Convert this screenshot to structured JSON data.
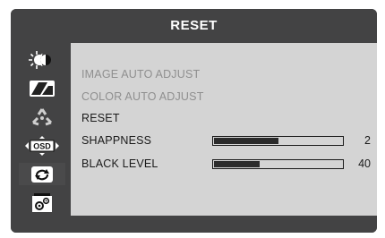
{
  "title": "RESET",
  "sidebar": {
    "items": [
      {
        "icon": "brightness-contrast-icon",
        "selected": false
      },
      {
        "icon": "image-icon",
        "selected": false
      },
      {
        "icon": "color-icon",
        "selected": false
      },
      {
        "icon": "osd-icon",
        "label": "OSD",
        "selected": false
      },
      {
        "icon": "reset-icon",
        "selected": true
      },
      {
        "icon": "setup-icon",
        "selected": false
      }
    ]
  },
  "menu": {
    "items": [
      {
        "label": "IMAGE AUTO ADJUST",
        "enabled": false
      },
      {
        "label": "COLOR AUTO ADJUST",
        "enabled": false
      },
      {
        "label": "RESET",
        "enabled": true
      },
      {
        "label": "SHAPPNESS",
        "enabled": true,
        "value": "2",
        "level": 0.5
      },
      {
        "label": "BLACK LEVEL",
        "enabled": true,
        "value": "40",
        "level": 0.36
      }
    ]
  },
  "colors": {
    "frame": "#434344",
    "panel": "#d4d4d4",
    "text_active": "#1a1a1a",
    "text_disabled": "#8f8f8f"
  }
}
